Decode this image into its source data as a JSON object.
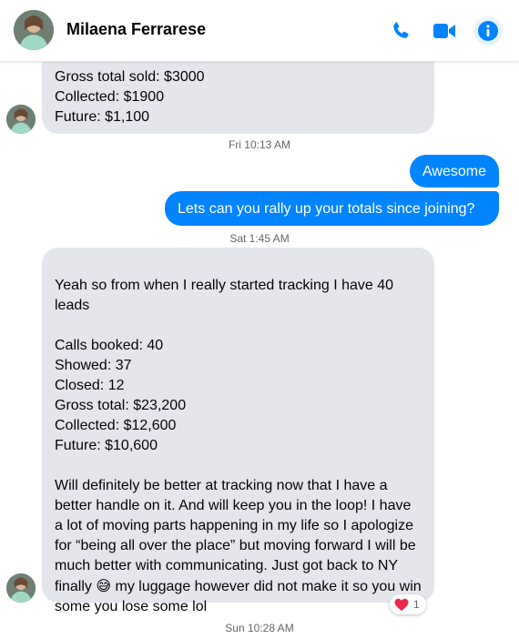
{
  "header": {
    "contact_name": "Milaena Ferrarese",
    "accent_color": "#0084ff",
    "icons": [
      "phone-icon",
      "video-camera-icon",
      "info-icon"
    ]
  },
  "messages": {
    "m1": "Gross total sold: $3000\nCollected: $1900\nFuture: $1,100",
    "ts1": "Fri 10:13 AM",
    "m2": "Awesome",
    "m3": "Lets can you rally up your totals since joining?",
    "ts2": "Sat 1:45 AM",
    "m4_part1": "Yeah so from when I really started tracking I have 40 leads\n\nCalls booked: 40\nShowed: 37\nClosed: 12\nGross total: $23,200\nCollected: $12,600\nFuture: $10,600\n\nWill definitely be better at tracking now that I have a better handle on it. And will keep you in the loop! I have a lot of moving parts happening in my life so I apologize for “being all over the place” but moving forward I will be much better with communicating. Just got back to NY finally ",
    "m4_emoji": "😅",
    "m4_part2": " my luggage however did not make it so you win some you lose some lol",
    "reaction_count": "1",
    "ts3": "Sun 10:28 AM"
  }
}
